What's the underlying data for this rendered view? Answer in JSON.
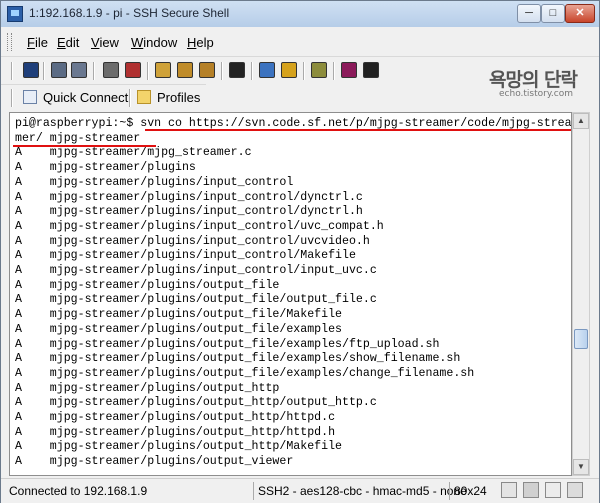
{
  "window": {
    "title": "1:192.168.1.9 - pi - SSH Secure Shell",
    "min_label": "─",
    "max_label": "□",
    "close_label": "✕"
  },
  "menu": [
    {
      "mnemonic": "F",
      "rest": "ile"
    },
    {
      "mnemonic": "E",
      "rest": "dit"
    },
    {
      "mnemonic": "V",
      "rest": "iew"
    },
    {
      "mnemonic": "W",
      "rest": "indow"
    },
    {
      "mnemonic": "H",
      "rest": "elp"
    }
  ],
  "toolbar_icons": [
    {
      "name": "save-icon",
      "color": "#1f3f7a"
    },
    {
      "name": "print-icon",
      "color": "#5b6b84"
    },
    {
      "name": "print-preview-icon",
      "color": "#6a7890"
    },
    {
      "name": "disconnect-icon",
      "color": "#6c6c6c"
    },
    {
      "name": "settings-icon",
      "color": "#b03030"
    },
    {
      "name": "copy-icon",
      "color": "#cfa23a"
    },
    {
      "name": "paste-icon",
      "color": "#c08c2a"
    },
    {
      "name": "paste-special-icon",
      "color": "#b58027"
    },
    {
      "name": "find-icon",
      "color": "#222222"
    },
    {
      "name": "new-window-icon",
      "color": "#3c73c0"
    },
    {
      "name": "file-transfer-icon",
      "color": "#d5a21d"
    },
    {
      "name": "profile-settings-icon",
      "color": "#8c8c3c"
    },
    {
      "name": "help-topics-icon",
      "color": "#8b1a5a"
    },
    {
      "name": "context-help-icon",
      "color": "#222222"
    }
  ],
  "quickbar": {
    "quick_connect": "Quick Connect",
    "profiles": "Profiles"
  },
  "logo": {
    "main": "욕망의 단락",
    "sub": "echo.tistory.com"
  },
  "terminal": {
    "lines": [
      "pi@raspberrypi:~$ svn co https://svn.code.sf.net/p/mjpg-streamer/code/mjpg-strea",
      "mer/ mjpg-streamer",
      "A    mjpg-streamer/mjpg_streamer.c",
      "A    mjpg-streamer/plugins",
      "A    mjpg-streamer/plugins/input_control",
      "A    mjpg-streamer/plugins/input_control/dynctrl.c",
      "A    mjpg-streamer/plugins/input_control/dynctrl.h",
      "A    mjpg-streamer/plugins/input_control/uvc_compat.h",
      "A    mjpg-streamer/plugins/input_control/uvcvideo.h",
      "A    mjpg-streamer/plugins/input_control/Makefile",
      "A    mjpg-streamer/plugins/input_control/input_uvc.c",
      "A    mjpg-streamer/plugins/output_file",
      "A    mjpg-streamer/plugins/output_file/output_file.c",
      "A    mjpg-streamer/plugins/output_file/Makefile",
      "A    mjpg-streamer/plugins/output_file/examples",
      "A    mjpg-streamer/plugins/output_file/examples/ftp_upload.sh",
      "A    mjpg-streamer/plugins/output_file/examples/show_filename.sh",
      "A    mjpg-streamer/plugins/output_file/examples/change_filename.sh",
      "A    mjpg-streamer/plugins/output_http",
      "A    mjpg-streamer/plugins/output_http/output_http.c",
      "A    mjpg-streamer/plugins/output_http/httpd.c",
      "A    mjpg-streamer/plugins/output_http/httpd.h",
      "A    mjpg-streamer/plugins/output_http/Makefile",
      "A    mjpg-streamer/plugins/output_viewer"
    ]
  },
  "scrollbar": {
    "up_label": "▲",
    "down_label": "▼"
  },
  "status": {
    "connection": "Connected to 192.168.1.9",
    "cipher": "SSH2 - aes128-cbc - hmac-md5 - none",
    "size": "80x24"
  }
}
